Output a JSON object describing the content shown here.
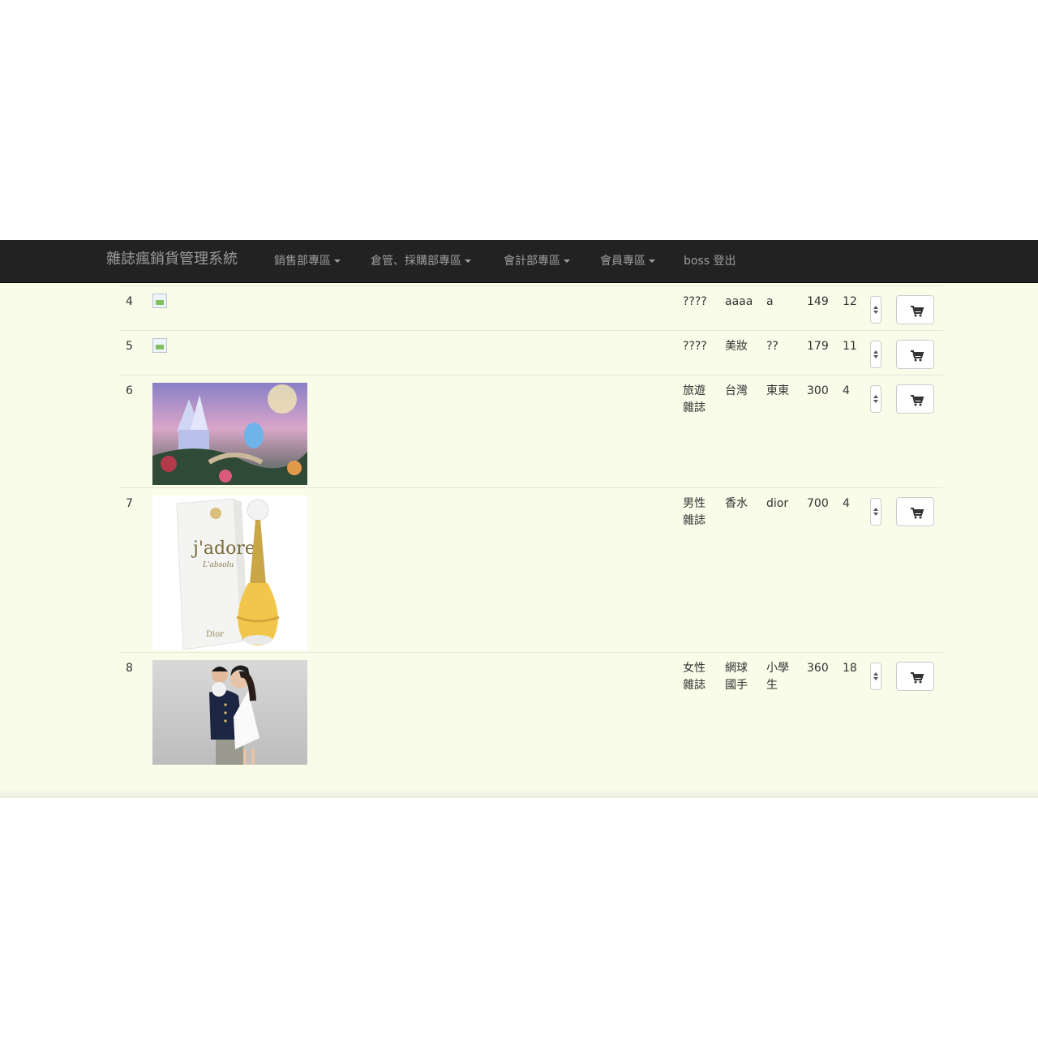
{
  "navbar": {
    "brand": "雜誌瘋銷貨管理系統",
    "items": [
      {
        "label": "銷售部專區",
        "dropdown": true
      },
      {
        "label": "倉管、採購部專區",
        "dropdown": true
      },
      {
        "label": "會計部專區",
        "dropdown": true
      },
      {
        "label": "會員專區",
        "dropdown": true
      },
      {
        "label": "boss 登出",
        "dropdown": false
      }
    ]
  },
  "products": [
    {
      "num": "4",
      "image": "broken",
      "category": "????",
      "subcategory": "aaaa",
      "name": "a",
      "price": "149",
      "stock": "12"
    },
    {
      "num": "5",
      "image": "broken",
      "category": "????",
      "subcategory": "美妝",
      "name": "??",
      "price": "179",
      "stock": "11"
    },
    {
      "num": "6",
      "image": "fairytale-castle-painting",
      "category": "旅遊雜誌",
      "subcategory": "台灣",
      "name": "東東",
      "price": "300",
      "stock": "4"
    },
    {
      "num": "7",
      "image": "dior-jadore-perfume",
      "category": "男性雜誌",
      "subcategory": "香水",
      "name": "dior",
      "price": "700",
      "stock": "4"
    },
    {
      "num": "8",
      "image": "couple-photo",
      "category": "女性雜誌",
      "subcategory": "網球國手",
      "name": "小學生",
      "price": "360",
      "stock": "18"
    }
  ],
  "colors": {
    "navbar_bg": "#222222",
    "navbar_text": "#9d9d9d",
    "page_bg": "#f8fce9",
    "row_border": "#e3e7d6"
  },
  "icons": {
    "cart": "shopping-cart-icon",
    "stepper": "quantity-stepper"
  }
}
